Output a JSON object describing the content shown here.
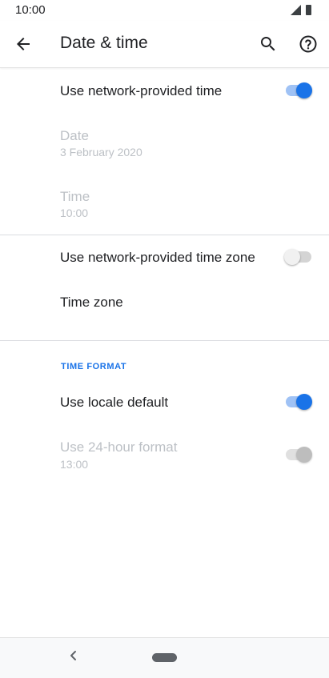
{
  "status_bar": {
    "time": "10:00",
    "icons": [
      "signal-icon",
      "battery-icon"
    ]
  },
  "app_bar": {
    "title": "Date & time",
    "back_icon": "arrow-back-icon",
    "search_icon": "search-icon",
    "help_icon": "help-icon"
  },
  "settings": {
    "network_time": {
      "title": "Use network-provided time",
      "enabled": true
    },
    "date": {
      "title": "Date",
      "value": "3 February 2020",
      "disabled": true
    },
    "time": {
      "title": "Time",
      "value": "10:00",
      "disabled": true
    },
    "network_timezone": {
      "title": "Use network-provided time zone",
      "enabled": false
    },
    "time_zone": {
      "title": "Time zone"
    }
  },
  "time_format": {
    "header": "TIME FORMAT",
    "locale_default": {
      "title": "Use locale default",
      "enabled": true
    },
    "hour24": {
      "title": "Use 24-hour format",
      "value": "13:00",
      "enabled": true,
      "disabled": true
    }
  },
  "colors": {
    "accent": "#1a73e8",
    "track_on": "#9fc2f5",
    "text_primary": "#202124",
    "text_disabled": "#bdc1c6"
  },
  "nav_bar": {
    "back_icon": "nav-back-icon",
    "home_icon": "home-pill-icon"
  }
}
